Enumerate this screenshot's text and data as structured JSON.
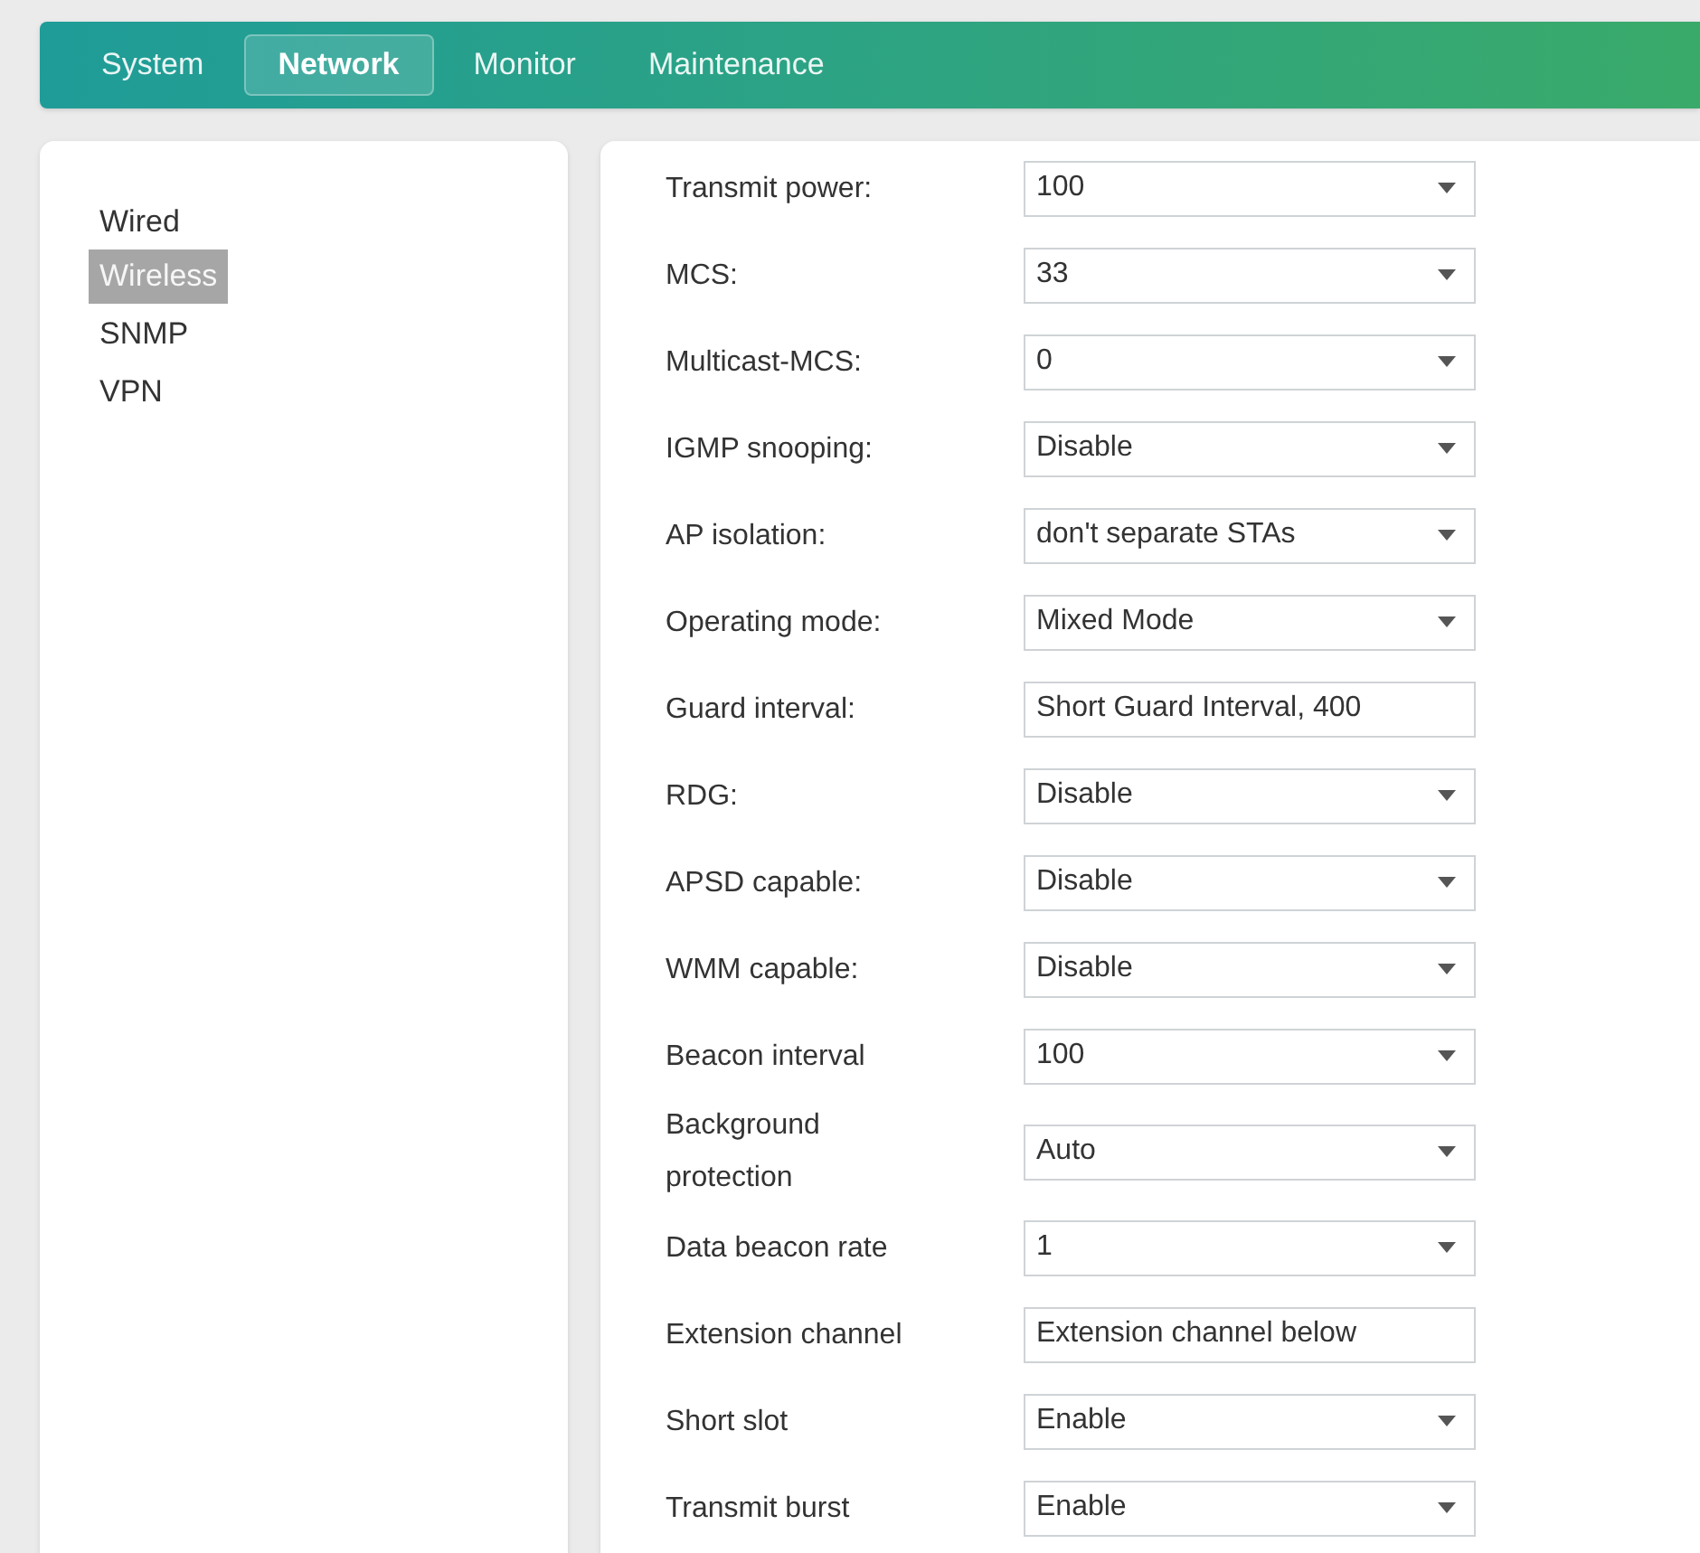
{
  "tabs": [
    {
      "label": "System",
      "selected": false
    },
    {
      "label": "Network",
      "selected": true
    },
    {
      "label": "Monitor",
      "selected": false
    },
    {
      "label": "Maintenance",
      "selected": false
    }
  ],
  "sidebar": {
    "items": [
      {
        "label": "Wired",
        "selected": false
      },
      {
        "label": "Wireless",
        "selected": true
      },
      {
        "label": "SNMP",
        "selected": false
      },
      {
        "label": "VPN",
        "selected": false
      }
    ]
  },
  "settings": [
    {
      "label": "Transmit power:",
      "value": "100",
      "arrow": true
    },
    {
      "label": "MCS:",
      "value": "33",
      "arrow": true
    },
    {
      "label": "Multicast-MCS:",
      "value": "0",
      "arrow": true
    },
    {
      "label": "IGMP snooping:",
      "value": "Disable",
      "arrow": true
    },
    {
      "label": "AP isolation:",
      "value": "don't separate STAs",
      "arrow": true
    },
    {
      "label": "Operating mode:",
      "value": "Mixed Mode",
      "arrow": true
    },
    {
      "label": "Guard interval:",
      "value": "Short Guard Interval, 400",
      "arrow": false
    },
    {
      "label": "RDG:",
      "value": "Disable",
      "arrow": true
    },
    {
      "label": "APSD capable:",
      "value": "Disable",
      "arrow": true
    },
    {
      "label": "WMM capable:",
      "value": "Disable",
      "arrow": true
    },
    {
      "label": "Beacon interval",
      "value": "100",
      "arrow": true
    },
    {
      "label": "Background protection",
      "value": "Auto",
      "arrow": true
    },
    {
      "label": "Data beacon rate",
      "value": "1",
      "arrow": true
    },
    {
      "label": "Extension channel",
      "value": "Extension channel below",
      "arrow": false
    },
    {
      "label": "Short slot",
      "value": "Enable",
      "arrow": true
    },
    {
      "label": "Transmit burst",
      "value": "Enable",
      "arrow": true
    }
  ]
}
